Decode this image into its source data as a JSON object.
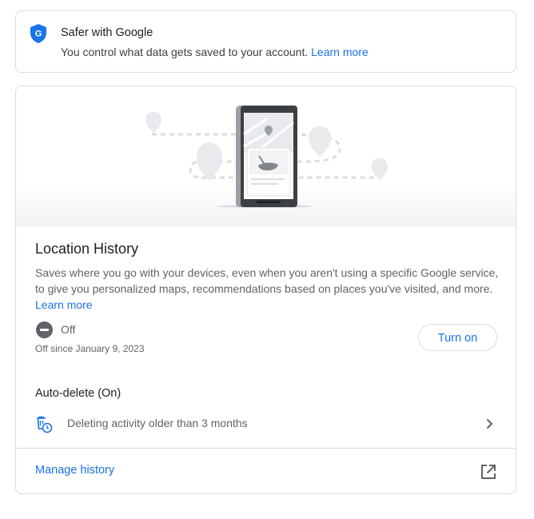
{
  "safer": {
    "title": "Safer with Google",
    "description": "You control what data gets saved to your account.",
    "learn_more": "Learn more",
    "icon": "google-shield-icon"
  },
  "location_history": {
    "title": "Location History",
    "description": "Saves where you go with your devices, even when you aren't using a specific Google service, to give you personalized maps, recommendations based on places you've visited, and more.",
    "learn_more": "Learn more",
    "status": "Off",
    "status_since": "Off since January 9, 2023",
    "turn_on_label": "Turn on"
  },
  "auto_delete": {
    "title": "Auto-delete (On)",
    "description": "Deleting activity older than 3 months"
  },
  "manage_history": {
    "label": "Manage history"
  },
  "colors": {
    "accent": "#1a73e8",
    "border": "#dadce0",
    "text_secondary": "#5f6368"
  }
}
